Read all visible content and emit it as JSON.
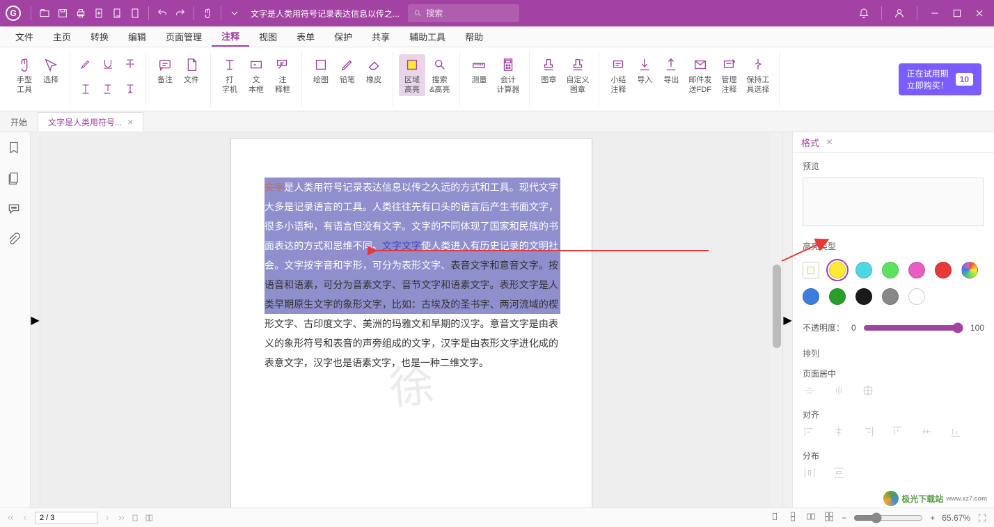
{
  "titlebar": {
    "doc_title": "文字是人类用符号记录表达信息以传之...",
    "search_placeholder": "搜索"
  },
  "menu": {
    "items": [
      "文件",
      "主页",
      "转换",
      "编辑",
      "页面管理",
      "注释",
      "视图",
      "表单",
      "保护",
      "共享",
      "辅助工具",
      "帮助"
    ],
    "active_index": 5
  },
  "ribbon": {
    "hand": "手型\n工具",
    "select": "选择",
    "note": "备注",
    "file": "文件",
    "typewriter": "打\n字机",
    "textbox": "文\n本框",
    "callout": "注\n释框",
    "draw": "绘图",
    "pencil": "铅笔",
    "eraser": "橡皮",
    "areahl": "区域\n高亮",
    "searchhl": "搜索\n&高亮",
    "measure": "测量",
    "calc": "会计\n计算器",
    "stamp": "图章",
    "customstamp": "自定义\n图章",
    "summary": "小结\n注释",
    "import": "导入",
    "export": "导出",
    "emailpdf": "邮件发\n送FDF",
    "manage": "管理\n注释",
    "keeptool": "保持工\n具选择",
    "trial_line1": "正在试用期",
    "trial_line2": "立即购买！",
    "trial_days": "10"
  },
  "tabs": {
    "start": "开始",
    "doc": "文字是人类用符号..."
  },
  "document": {
    "highlighted": "文字是人类用符号记录表达信息以传之久远的方式和工具。现代文字大多是记录语言的工具。人类往往先有口头的语言后产生书面文字，很多小语种，有语言但没有文字。文字的不同体现了国家和民族的书面表达的方式和思维不同。文字文字使人类进入有历史记录的文明社会。文字按字音和字形，可分为表形文字、",
    "strike1": "文字",
    "link1": "文字文字",
    "rest": "表音文字和意音文字。按语音和语素，可分为音素文字、音节文字和语素文字。表形文字是人类早期原生文字的象形文字，比如：古埃及的圣书字、两河流域的楔形文字、古印度文字、美洲的玛雅文和早期的汉字。意音文字是由表义的象形符号和表音的声旁组成的文字，汉字是由表形文字进化成的表意文字，汉字也是语素文字，也是一种二维文字。",
    "watermark": "徐"
  },
  "rightpanel": {
    "tab": "格式",
    "preview": "预览",
    "highlight_type": "高亮类型",
    "opacity_label": "不透明度：",
    "opacity_min": "0",
    "opacity_max": "100",
    "arrange": "排列",
    "page_center": "页面居中",
    "align": "对齐",
    "distribute": "分布",
    "colors": [
      {
        "hex": "#ffe933",
        "name": "yellow",
        "selected": true
      },
      {
        "hex": "#4dd8e6",
        "name": "cyan"
      },
      {
        "hex": "#5de25d",
        "name": "green"
      },
      {
        "hex": "#e85dc1",
        "name": "magenta"
      },
      {
        "hex": "#e83838",
        "name": "red"
      },
      {
        "hex": "#3d7de0",
        "name": "blue"
      },
      {
        "hex": "#2a9e2a",
        "name": "darkgreen"
      },
      {
        "hex": "#1a1a1a",
        "name": "black"
      },
      {
        "hex": "#888888",
        "name": "gray"
      },
      {
        "hex": "#ffffff",
        "name": "white"
      }
    ]
  },
  "statusbar": {
    "page": "2 / 3",
    "zoom": "65.67%"
  },
  "site_watermark": "极光下载站"
}
